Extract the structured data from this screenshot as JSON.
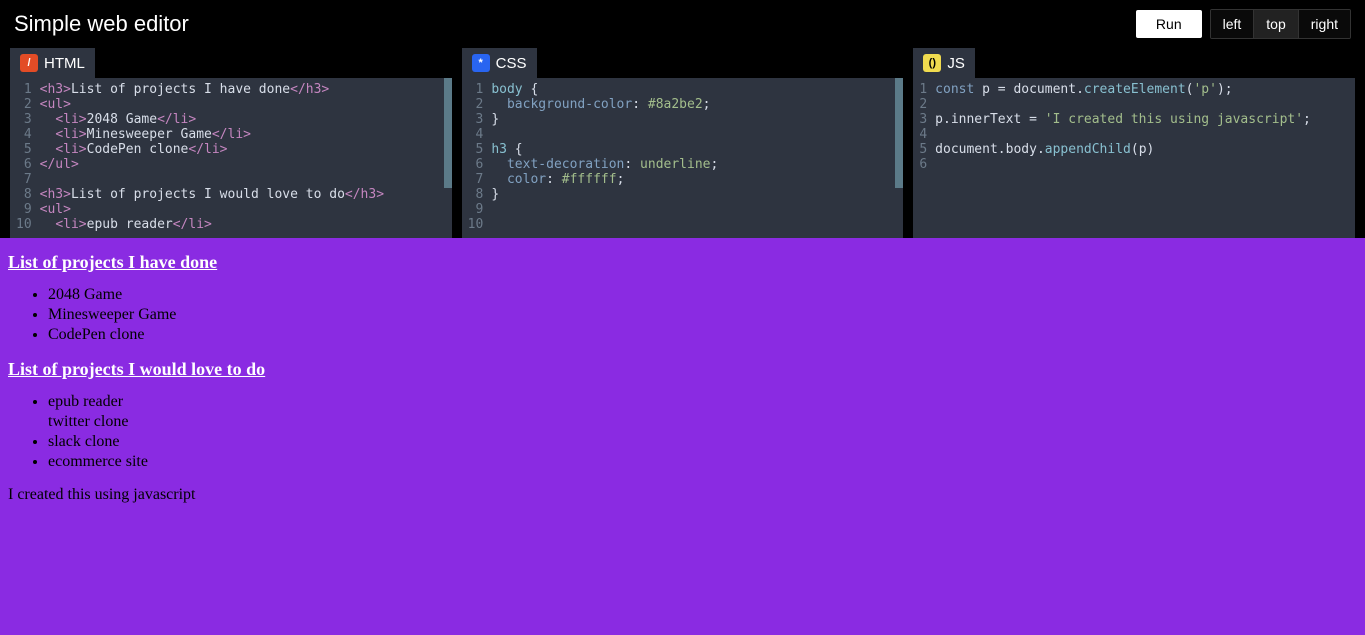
{
  "header": {
    "title": "Simple web editor",
    "run_label": "Run",
    "layout_left": "left",
    "layout_top": "top",
    "layout_right": "right",
    "active_layout": "top"
  },
  "panels": {
    "html": {
      "label": "HTML",
      "icon_glyph": "/",
      "lines": [
        {
          "n": "1",
          "tokens": [
            [
              "tag",
              "<h3>"
            ],
            [
              "txt",
              "List of projects I have done"
            ],
            [
              "tag",
              "</h3>"
            ]
          ]
        },
        {
          "n": "2",
          "tokens": [
            [
              "tag",
              "<ul>"
            ]
          ]
        },
        {
          "n": "3",
          "tokens": [
            [
              "txt",
              "  "
            ],
            [
              "tag",
              "<li>"
            ],
            [
              "txt",
              "2048 Game"
            ],
            [
              "tag",
              "</li>"
            ]
          ]
        },
        {
          "n": "4",
          "tokens": [
            [
              "txt",
              "  "
            ],
            [
              "tag",
              "<li>"
            ],
            [
              "txt",
              "Minesweeper Game"
            ],
            [
              "tag",
              "</li>"
            ]
          ]
        },
        {
          "n": "5",
          "tokens": [
            [
              "txt",
              "  "
            ],
            [
              "tag",
              "<li>"
            ],
            [
              "txt",
              "CodePen clone"
            ],
            [
              "tag",
              "</li>"
            ]
          ]
        },
        {
          "n": "6",
          "tokens": [
            [
              "tag",
              "</ul>"
            ]
          ]
        },
        {
          "n": "7",
          "tokens": []
        },
        {
          "n": "8",
          "tokens": [
            [
              "tag",
              "<h3>"
            ],
            [
              "txt",
              "List of projects I would love to do"
            ],
            [
              "tag",
              "</h3>"
            ]
          ]
        },
        {
          "n": "9",
          "tokens": [
            [
              "tag",
              "<ul>"
            ]
          ]
        },
        {
          "n": "10",
          "tokens": [
            [
              "txt",
              "  "
            ],
            [
              "tag",
              "<li>"
            ],
            [
              "txt",
              "epub reader"
            ],
            [
              "tag",
              "</li>"
            ]
          ]
        }
      ]
    },
    "css": {
      "label": "CSS",
      "icon_glyph": "*",
      "lines": [
        {
          "n": "1",
          "tokens": [
            [
              "sel",
              "body"
            ],
            [
              "punc",
              " {"
            ]
          ]
        },
        {
          "n": "2",
          "tokens": [
            [
              "txt",
              "  "
            ],
            [
              "prop",
              "background-color"
            ],
            [
              "punc",
              ": "
            ],
            [
              "val",
              "#8a2be2"
            ],
            [
              "punc",
              ";"
            ]
          ]
        },
        {
          "n": "3",
          "tokens": [
            [
              "punc",
              "}"
            ]
          ]
        },
        {
          "n": "4",
          "tokens": []
        },
        {
          "n": "5",
          "tokens": [
            [
              "sel",
              "h3"
            ],
            [
              "punc",
              " {"
            ]
          ]
        },
        {
          "n": "6",
          "tokens": [
            [
              "txt",
              "  "
            ],
            [
              "prop",
              "text-decoration"
            ],
            [
              "punc",
              ": "
            ],
            [
              "val",
              "underline"
            ],
            [
              "punc",
              ";"
            ]
          ]
        },
        {
          "n": "7",
          "tokens": [
            [
              "txt",
              "  "
            ],
            [
              "prop",
              "color"
            ],
            [
              "punc",
              ": "
            ],
            [
              "val",
              "#ffffff"
            ],
            [
              "punc",
              ";"
            ]
          ]
        },
        {
          "n": "8",
          "tokens": [
            [
              "punc",
              "}"
            ]
          ]
        },
        {
          "n": "9",
          "tokens": []
        },
        {
          "n": "10",
          "tokens": []
        }
      ]
    },
    "js": {
      "label": "JS",
      "icon_glyph": "()",
      "lines": [
        {
          "n": "1",
          "tokens": [
            [
              "kw",
              "const"
            ],
            [
              "txt",
              " "
            ],
            [
              "ident",
              "p"
            ],
            [
              "txt",
              " = "
            ],
            [
              "ident",
              "document"
            ],
            [
              "punc",
              "."
            ],
            [
              "fn",
              "createElement"
            ],
            [
              "punc",
              "("
            ],
            [
              "str",
              "'p'"
            ],
            [
              "punc",
              ");"
            ]
          ]
        },
        {
          "n": "2",
          "tokens": []
        },
        {
          "n": "3",
          "tokens": [
            [
              "ident",
              "p"
            ],
            [
              "punc",
              "."
            ],
            [
              "ident",
              "innerText"
            ],
            [
              "txt",
              " = "
            ],
            [
              "str",
              "'I created this using javascript'"
            ],
            [
              "punc",
              ";"
            ]
          ]
        },
        {
          "n": "4",
          "tokens": []
        },
        {
          "n": "5",
          "tokens": [
            [
              "ident",
              "document"
            ],
            [
              "punc",
              "."
            ],
            [
              "ident",
              "body"
            ],
            [
              "punc",
              "."
            ],
            [
              "fn",
              "appendChild"
            ],
            [
              "punc",
              "("
            ],
            [
              "ident",
              "p"
            ],
            [
              "punc",
              ")"
            ]
          ]
        },
        {
          "n": "6",
          "tokens": []
        }
      ]
    }
  },
  "output": {
    "heading1": "List of projects I have done",
    "list1": [
      "2048 Game",
      "Minesweeper Game",
      "CodePen clone"
    ],
    "heading2": "List of projects I would love to do",
    "list2": [
      {
        "text": "epub reader",
        "bullet": true
      },
      {
        "text": "twitter clone",
        "bullet": false
      },
      {
        "text": "slack clone",
        "bullet": true
      },
      {
        "text": "ecommerce site",
        "bullet": true
      }
    ],
    "js_paragraph": "I created this using javascript"
  }
}
